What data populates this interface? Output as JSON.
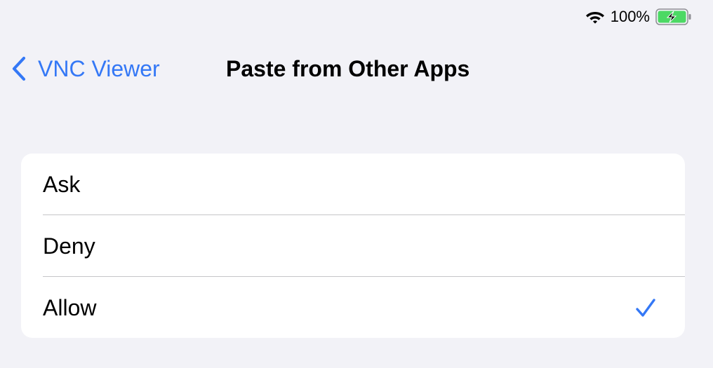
{
  "status_bar": {
    "wifi_icon": "wifi-icon",
    "battery_percent": "100%",
    "battery_icon": "battery-charging-icon",
    "battery_fill": 1.0,
    "battery_color": "#4cd964"
  },
  "nav": {
    "back_icon": "chevron-left-icon",
    "back_label": "VNC Viewer",
    "title": "Paste from Other Apps"
  },
  "options": [
    {
      "label": "Ask",
      "selected": false
    },
    {
      "label": "Deny",
      "selected": false
    },
    {
      "label": "Allow",
      "selected": true
    }
  ],
  "colors": {
    "accent": "#3478f6",
    "background": "#f2f2f7",
    "cell": "#ffffff",
    "separator": "#c6c6c8"
  }
}
